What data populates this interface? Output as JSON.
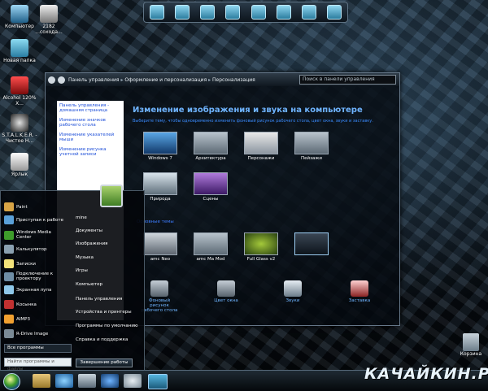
{
  "desktop": {
    "icons": [
      {
        "label": "Компьютер"
      },
      {
        "label": "2182 ...сохода..."
      },
      {
        "label": "Новая папка"
      },
      {
        "label": "Alcohol 120% X..."
      },
      {
        "label": "S.T.A.L.K.E.R. - Чистое Н..."
      },
      {
        "label": "Ярлык"
      }
    ],
    "recycle_bin": "Корзина"
  },
  "window": {
    "breadcrumb": [
      "Панель управления",
      "Оформление и персонализация",
      "Персонализация"
    ],
    "search_placeholder": "Поиск в панели управления",
    "left_links": [
      "Панель управления - домашняя страница",
      "Изменение значков рабочего стола",
      "Изменение указателей мыши",
      "Изменение рисунка учетной записи"
    ],
    "title": "Изменение изображения и звука на компьютере",
    "subtitle": "Выберите тему, чтобы одновременно изменить фоновый рисунок рабочего стола, цвет окна, звуки и заставку.",
    "themes_row1": [
      "Windows 7",
      "Архитектура",
      "Персонажи",
      "Пейзажи"
    ],
    "themes_row2": [
      "Природа",
      "Сцены"
    ],
    "section_label": "Основные темы",
    "themes_row3": [
      "amc Neo",
      "amc Ma Mod",
      "Full Glass v2",
      ""
    ],
    "bottom_items": [
      {
        "label": "Фоновый рисунок рабочего стола"
      },
      {
        "label": "Цвет окна"
      },
      {
        "label": "Звуки"
      },
      {
        "label": "Заставка"
      }
    ]
  },
  "start_menu": {
    "left_items": [
      "Paint",
      "Приступая к работе",
      "Windows Media Center",
      "Калькулятор",
      "Записки",
      "Подключение к проектору",
      "Экранная лупа",
      "Косынка",
      "AIMP3",
      "R-Drive Image"
    ],
    "right_items": [
      "mine",
      "Документы",
      "Изображения",
      "Музыка",
      "Игры",
      "Компьютер",
      "Панель управления",
      "Устройства и принтеры",
      "Программы по умолчанию",
      "Справка и поддержка"
    ],
    "all_programs": "Все программы",
    "search_placeholder": "Найти программы и файлы",
    "shutdown": "Завершение работы"
  },
  "watermark": "КАЧАЙКИН.РУ",
  "colors": {
    "link_blue": "#6fb4ff",
    "accent_green": "#3e9c2b"
  }
}
